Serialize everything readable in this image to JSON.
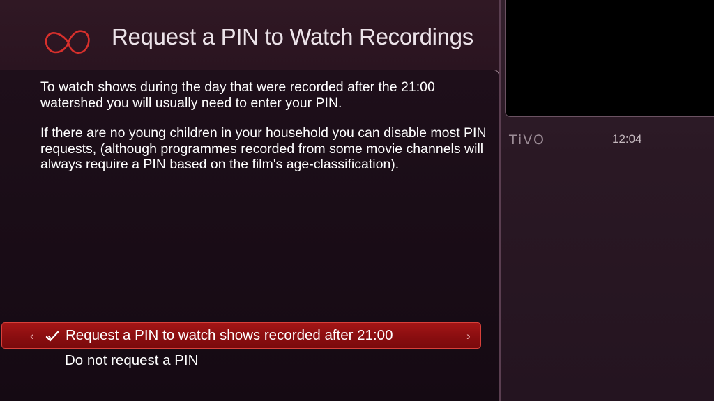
{
  "header": {
    "title": "Request a PIN to Watch Recordings",
    "logo_icon": "virgin-infinity-logo"
  },
  "content": {
    "paragraph_1": "To watch shows during the day that were recorded after the 21:00 watershed you will usually need to enter your PIN.",
    "paragraph_2": "If there are no young children in your household you can disable most PIN requests, (although programmes recorded from some movie channels will always require a PIN based on the film's age-classification)."
  },
  "options": {
    "selected": {
      "label": "Request a PIN to watch shows recorded after 21:00",
      "left_arrow": "‹",
      "right_arrow": "›"
    },
    "second": {
      "label": "Do not request a PIN"
    }
  },
  "sidebar": {
    "brand": "TiVO",
    "time": "12:04"
  },
  "colors": {
    "accent_red": "#a31616",
    "logo_red": "#d8302c",
    "background": "#1a0c16"
  }
}
